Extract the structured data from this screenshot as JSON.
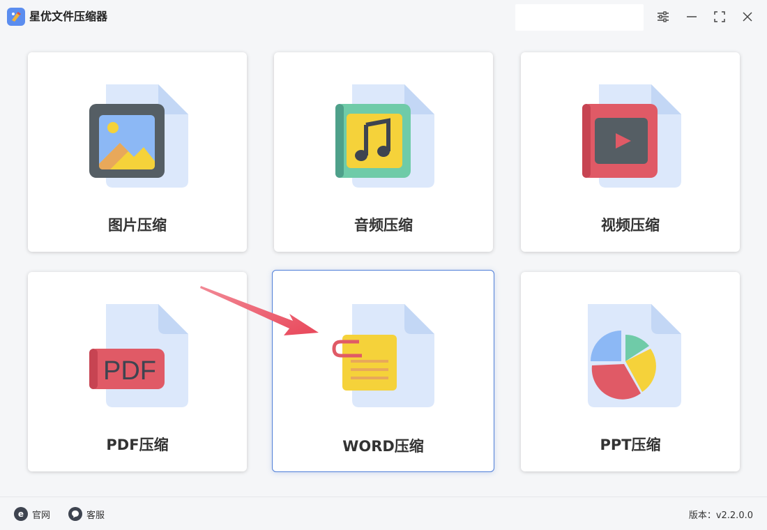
{
  "app": {
    "title": "星优文件压缩器"
  },
  "cards": [
    {
      "label": "图片压缩",
      "icon": "image-file-icon"
    },
    {
      "label": "音频压缩",
      "icon": "audio-file-icon"
    },
    {
      "label": "视频压缩",
      "icon": "video-file-icon"
    },
    {
      "label": "PDF压缩",
      "icon": "pdf-file-icon",
      "badge": "PDF"
    },
    {
      "label": "WORD压缩",
      "icon": "word-file-icon",
      "selected": true
    },
    {
      "label": "PPT压缩",
      "icon": "ppt-file-icon"
    }
  ],
  "footer": {
    "website_label": "官网",
    "website_icon_text": "e",
    "support_label": "客服",
    "version_label": "版本：v2.2.0.0"
  },
  "colors": {
    "accent": "#4f7ed8",
    "doc_bg": "#dce8fb",
    "doc_fold": "#c3d7f5",
    "red": "#e05a66",
    "yellow": "#f5d23a",
    "teal": "#6fcba8",
    "slate": "#555e64",
    "sky": "#8cb8f5"
  }
}
